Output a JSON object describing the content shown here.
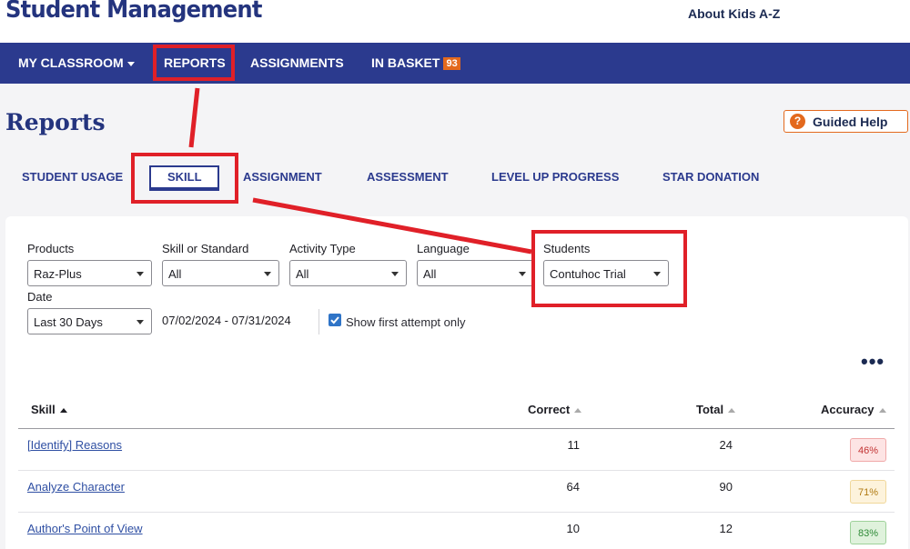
{
  "header": {
    "app_title": "Student Management",
    "about_link": "About Kids A-Z"
  },
  "nav": {
    "my_classroom": "MY CLASSROOM",
    "reports": "REPORTS",
    "assignments": "ASSIGNMENTS",
    "in_basket": "IN BASKET",
    "in_basket_count": "93"
  },
  "page": {
    "title": "Reports",
    "guided_help_icon": "?",
    "guided_help": "Guided Help"
  },
  "tabs": [
    {
      "label": "STUDENT USAGE"
    },
    {
      "label": "SKILL",
      "active": true
    },
    {
      "label": "ASSIGNMENT"
    },
    {
      "label": "ASSESSMENT"
    },
    {
      "label": "LEVEL UP PROGRESS"
    },
    {
      "label": "STAR DONATION"
    }
  ],
  "filters": {
    "products": {
      "label": "Products",
      "value": "Raz-Plus"
    },
    "skill_standard": {
      "label": "Skill or Standard",
      "value": "All"
    },
    "activity_type": {
      "label": "Activity Type",
      "value": "All"
    },
    "language": {
      "label": "Language",
      "value": "All"
    },
    "students": {
      "label": "Students",
      "value": "Contuhoc Trial"
    },
    "date": {
      "label": "Date",
      "value": "Last 30 Days"
    },
    "date_range": "07/02/2024 - 07/31/2024",
    "first_attempt": {
      "label": "Show first attempt only",
      "checked": true
    }
  },
  "more_icon": "•••",
  "table": {
    "columns": [
      "Skill",
      "Correct",
      "Total",
      "Accuracy"
    ],
    "rows": [
      {
        "skill": "[Identify] Reasons",
        "correct": "11",
        "total": "24",
        "accuracy": "46%",
        "level": "low"
      },
      {
        "skill": "Analyze Character",
        "correct": "64",
        "total": "90",
        "accuracy": "71%",
        "level": "mid"
      },
      {
        "skill": "Author's Point of View",
        "correct": "10",
        "total": "12",
        "accuracy": "83%",
        "level": "high"
      }
    ]
  },
  "colors": {
    "nav_bg": "#2b3a8e",
    "brand": "#24347e",
    "accent": "#e3691d",
    "highlight": "#e02028",
    "accuracy_low": "#fde4e4",
    "accuracy_mid": "#fdf3dc",
    "accuracy_high": "#dff2dc"
  }
}
